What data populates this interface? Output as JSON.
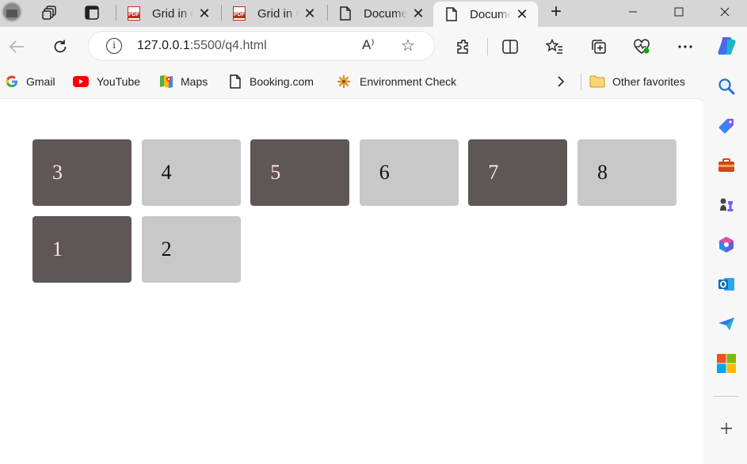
{
  "tabs": [
    {
      "title": "Grid in C",
      "favicon": "pdf-icon"
    },
    {
      "title": "Grid in C",
      "favicon": "pdf-icon"
    },
    {
      "title": "Document",
      "favicon": "document-icon"
    },
    {
      "title": "Document",
      "favicon": "document-icon",
      "active": true
    }
  ],
  "pdf_badge": "PDF",
  "address_bar": {
    "url_host": "127.0.0.1",
    "url_rest": ":5500/q4.html",
    "read_aloud": "A⁾"
  },
  "favorites": [
    {
      "label": "Gmail",
      "icon": "google-icon"
    },
    {
      "label": "YouTube",
      "icon": "youtube-icon"
    },
    {
      "label": "Maps",
      "icon": "maps-icon"
    },
    {
      "label": "Booking.com",
      "icon": "document-icon"
    },
    {
      "label": "Environment Check",
      "icon": "gear-icon"
    }
  ],
  "other_favorites": "Other favorites",
  "grid_items": [
    {
      "label": "3",
      "shade": "dark"
    },
    {
      "label": "4",
      "shade": "light"
    },
    {
      "label": "5",
      "shade": "dark"
    },
    {
      "label": "6",
      "shade": "light"
    },
    {
      "label": "7",
      "shade": "dark"
    },
    {
      "label": "8",
      "shade": "light"
    },
    {
      "label": "1",
      "shade": "dark"
    },
    {
      "label": "2",
      "shade": "light"
    }
  ],
  "colors": {
    "dark_cell": "#5e5756",
    "dark_cell_text": "#ffe4ec",
    "light_cell": "#c8c8c8",
    "light_cell_text": "#111111"
  }
}
